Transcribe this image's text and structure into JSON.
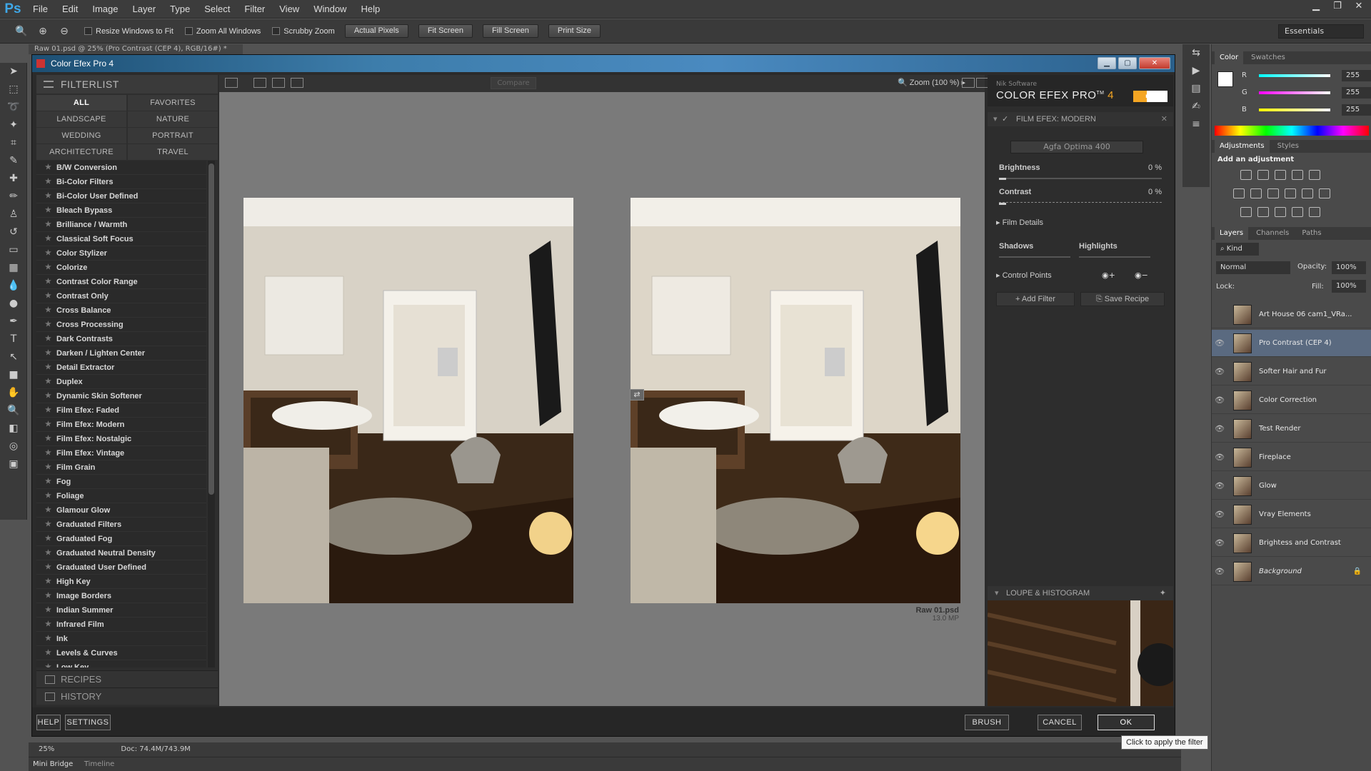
{
  "app": {
    "logo": "Ps",
    "menu": [
      "File",
      "Edit",
      "Image",
      "Layer",
      "Type",
      "Select",
      "Filter",
      "View",
      "Window",
      "Help"
    ]
  },
  "options_bar": {
    "checkboxes": [
      "Resize Windows to Fit",
      "Zoom All Windows",
      "Scrubby Zoom"
    ],
    "buttons": [
      "Actual Pixels",
      "Fit Screen",
      "Fill Screen",
      "Print Size"
    ],
    "workspace": "Essentials"
  },
  "doc_tab": "Raw 01.psd @ 25% (Pro Contrast (CEP 4), RGB/16#) *",
  "dialog": {
    "title": "Color Efex Pro 4",
    "filterlist_title": "FILTERLIST",
    "categories": [
      "ALL",
      "FAVORITES",
      "LANDSCAPE",
      "NATURE",
      "WEDDING",
      "PORTRAIT",
      "ARCHITECTURE",
      "TRAVEL"
    ],
    "filters": [
      "B/W Conversion",
      "Bi-Color Filters",
      "Bi-Color User Defined",
      "Bleach Bypass",
      "Brilliance / Warmth",
      "Classical Soft Focus",
      "Color Stylizer",
      "Colorize",
      "Contrast Color Range",
      "Contrast Only",
      "Cross Balance",
      "Cross Processing",
      "Dark Contrasts",
      "Darken / Lighten Center",
      "Detail Extractor",
      "Duplex",
      "Dynamic Skin Softener",
      "Film Efex: Faded",
      "Film Efex: Modern",
      "Film Efex: Nostalgic",
      "Film Efex: Vintage",
      "Film Grain",
      "Fog",
      "Foliage",
      "Glamour Glow",
      "Graduated Filters",
      "Graduated Fog",
      "Graduated Neutral Density",
      "Graduated User Defined",
      "High Key",
      "Image Borders",
      "Indian Summer",
      "Infrared Film",
      "Ink",
      "Levels & Curves",
      "Low Key"
    ],
    "recipes": "RECIPES",
    "history": "HISTORY",
    "compare": "Compare",
    "zoom": "Zoom (100 %)",
    "file_name": "Raw 01.psd",
    "file_mp": "13.0 MP",
    "brand_small": "Nik Software",
    "brand_title": "COLOR EFEX PRO",
    "brand_num": "4",
    "brand_logo": "nik",
    "filter_section": "FILM EFEX: MODERN",
    "preset": "Agfa Optima 400",
    "brightness_label": "Brightness",
    "brightness_value": "0 %",
    "contrast_label": "Contrast",
    "contrast_value": "0 %",
    "film_details": "Film Details",
    "shadows": "Shadows",
    "highlights": "Highlights",
    "control_points": "Control Points",
    "add_filter": "Add Filter",
    "save_recipe": "Save Recipe",
    "loupe": "LOUPE & HISTOGRAM",
    "help": "HELP",
    "settings": "SETTINGS",
    "brush": "BRUSH",
    "cancel": "CANCEL",
    "ok": "OK"
  },
  "color_panel": {
    "tabs": [
      "Color",
      "Swatches"
    ],
    "r": "255",
    "g": "255",
    "b": "255",
    "r_label": "R",
    "g_label": "G",
    "b_label": "B"
  },
  "adjustments": {
    "tabs": [
      "Adjustments",
      "Styles"
    ],
    "label": "Add an adjustment"
  },
  "layers_panel": {
    "tabs": [
      "Layers",
      "Channels",
      "Paths"
    ],
    "kind": "Kind",
    "blend": "Normal",
    "opacity_label": "Opacity:",
    "opacity": "100%",
    "lock_label": "Lock:",
    "fill_label": "Fill:",
    "fill": "100%",
    "layers": [
      "Art House 06 cam1_VRa...",
      "Pro Contrast (CEP 4)",
      "Softer Hair and Fur",
      "Color Correction",
      "Test Render",
      "Fireplace",
      "Glow",
      "Vray Elements",
      "Brightess and Contrast",
      "Background"
    ]
  },
  "status": {
    "zoom": "25%",
    "doc": "Doc: 74.4M/743.9M"
  },
  "bottom_tabs": [
    "Mini Bridge",
    "Timeline"
  ],
  "tooltip": "Click to apply the filter",
  "colors": {
    "accent": "#3fa8e8",
    "nik_orange": "#f5a623",
    "selected_layer": "#5a6a80"
  }
}
